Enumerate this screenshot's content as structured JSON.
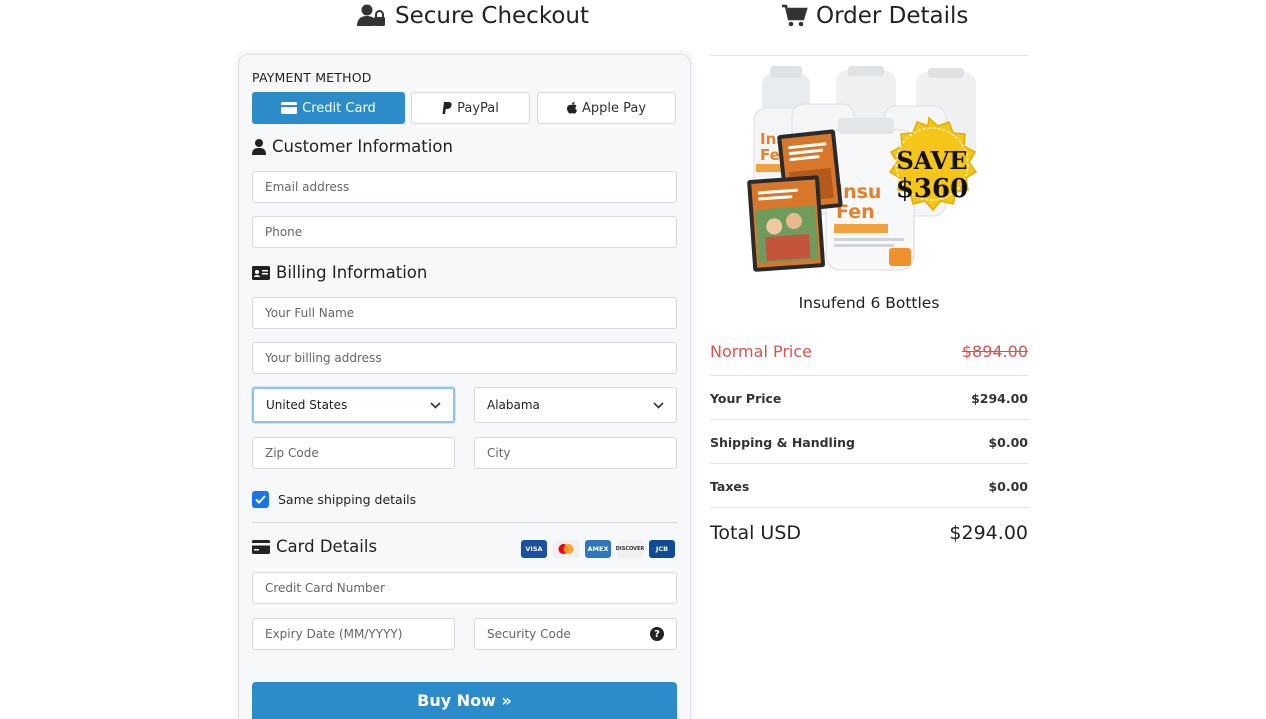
{
  "headings": {
    "secure_checkout": "Secure Checkout",
    "order_details": "Order Details"
  },
  "payment": {
    "label": "PAYMENT METHOD",
    "tabs": [
      {
        "label": "Credit Card",
        "icon": "credit-card-icon",
        "active": true
      },
      {
        "label": "PayPal",
        "icon": "paypal-icon",
        "active": false
      },
      {
        "label": "Apple Pay",
        "icon": "apple-icon",
        "active": false
      }
    ]
  },
  "customer": {
    "title": "Customer Information",
    "email_placeholder": "Email address",
    "phone_placeholder": "Phone"
  },
  "billing": {
    "title": "Billing Information",
    "name_placeholder": "Your Full Name",
    "address_placeholder": "Your billing address",
    "country_selected": "United States",
    "state_selected": "Alabama",
    "zip_placeholder": "Zip Code",
    "city_placeholder": "City",
    "same_shipping_label": "Same shipping details",
    "same_shipping_checked": true
  },
  "card": {
    "title": "Card Details",
    "brands": [
      "VISA",
      "mastercard",
      "AMEX",
      "DISCOVER",
      "JCB"
    ],
    "number_placeholder": "Credit Card Number",
    "expiry_placeholder": "Expiry Date (MM/YYYY)",
    "cvv_placeholder": "Security Code",
    "help_glyph": "?"
  },
  "buy_button": "Buy Now »",
  "order": {
    "product_name": "Insufend 6 Bottles",
    "badge_line1": "SAVE",
    "badge_line2": "$360",
    "normal_price_label": "Normal Price",
    "normal_price": "$894.00",
    "your_price_label": "Your Price",
    "your_price": "$294.00",
    "shipping_label": "Shipping & Handling",
    "shipping": "$0.00",
    "taxes_label": "Taxes",
    "taxes": "$0.00",
    "total_label": "Total USD",
    "total": "$294.00"
  },
  "colors": {
    "accent": "#2c8bc9",
    "strike_red": "#d9534f",
    "badge_yellow": "#f5c518"
  }
}
